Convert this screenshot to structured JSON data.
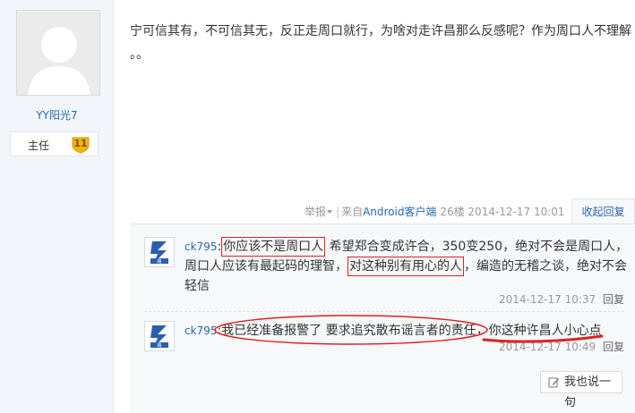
{
  "user": {
    "name": "YY阳光7",
    "rank_label": "主任",
    "level": "11"
  },
  "post": {
    "text_line1": "宁可信其有，不可信其无，反正走周口就行，为啥对走许昌那么反感呢？作为周口人不理解",
    "text_line2": "。。"
  },
  "meta": {
    "report": "举报",
    "from_prefix": "来自",
    "client": "Android客户端",
    "floor": "26楼",
    "time": "2014-12-17 10:01",
    "collapse": "收起回复"
  },
  "replies": [
    {
      "user": "ck795",
      "colon": ":",
      "seg1": "你应该不是周口人",
      "seg2": " 希望郑合变成许合，350变250，绝对不会是周口人，周口人应该有最起码的理智，",
      "seg3": "对这种别有用心的人",
      "seg4": "，编造的无稽之谈，绝对不会轻信",
      "time": "2014-12-17 10:37",
      "reply": "回复"
    },
    {
      "user": "ck795",
      "colon": ":",
      "seg1": "我已经准备报警了 要求追究散布谣言者的责任，",
      "seg2": "你这种许昌人小心点",
      "time": "2014-12-17 10:49",
      "reply": "回复"
    }
  ],
  "say_button": "我也说一句",
  "icons": {
    "avatar": "default-avatar-icon",
    "badge": "level-badge-icon",
    "reply_avatar": "ck795-avatar-icon",
    "pen": "pen-icon"
  },
  "colors": {
    "link": "#2a67b3",
    "highlight": "#e02020",
    "badge": "#f4b400"
  }
}
